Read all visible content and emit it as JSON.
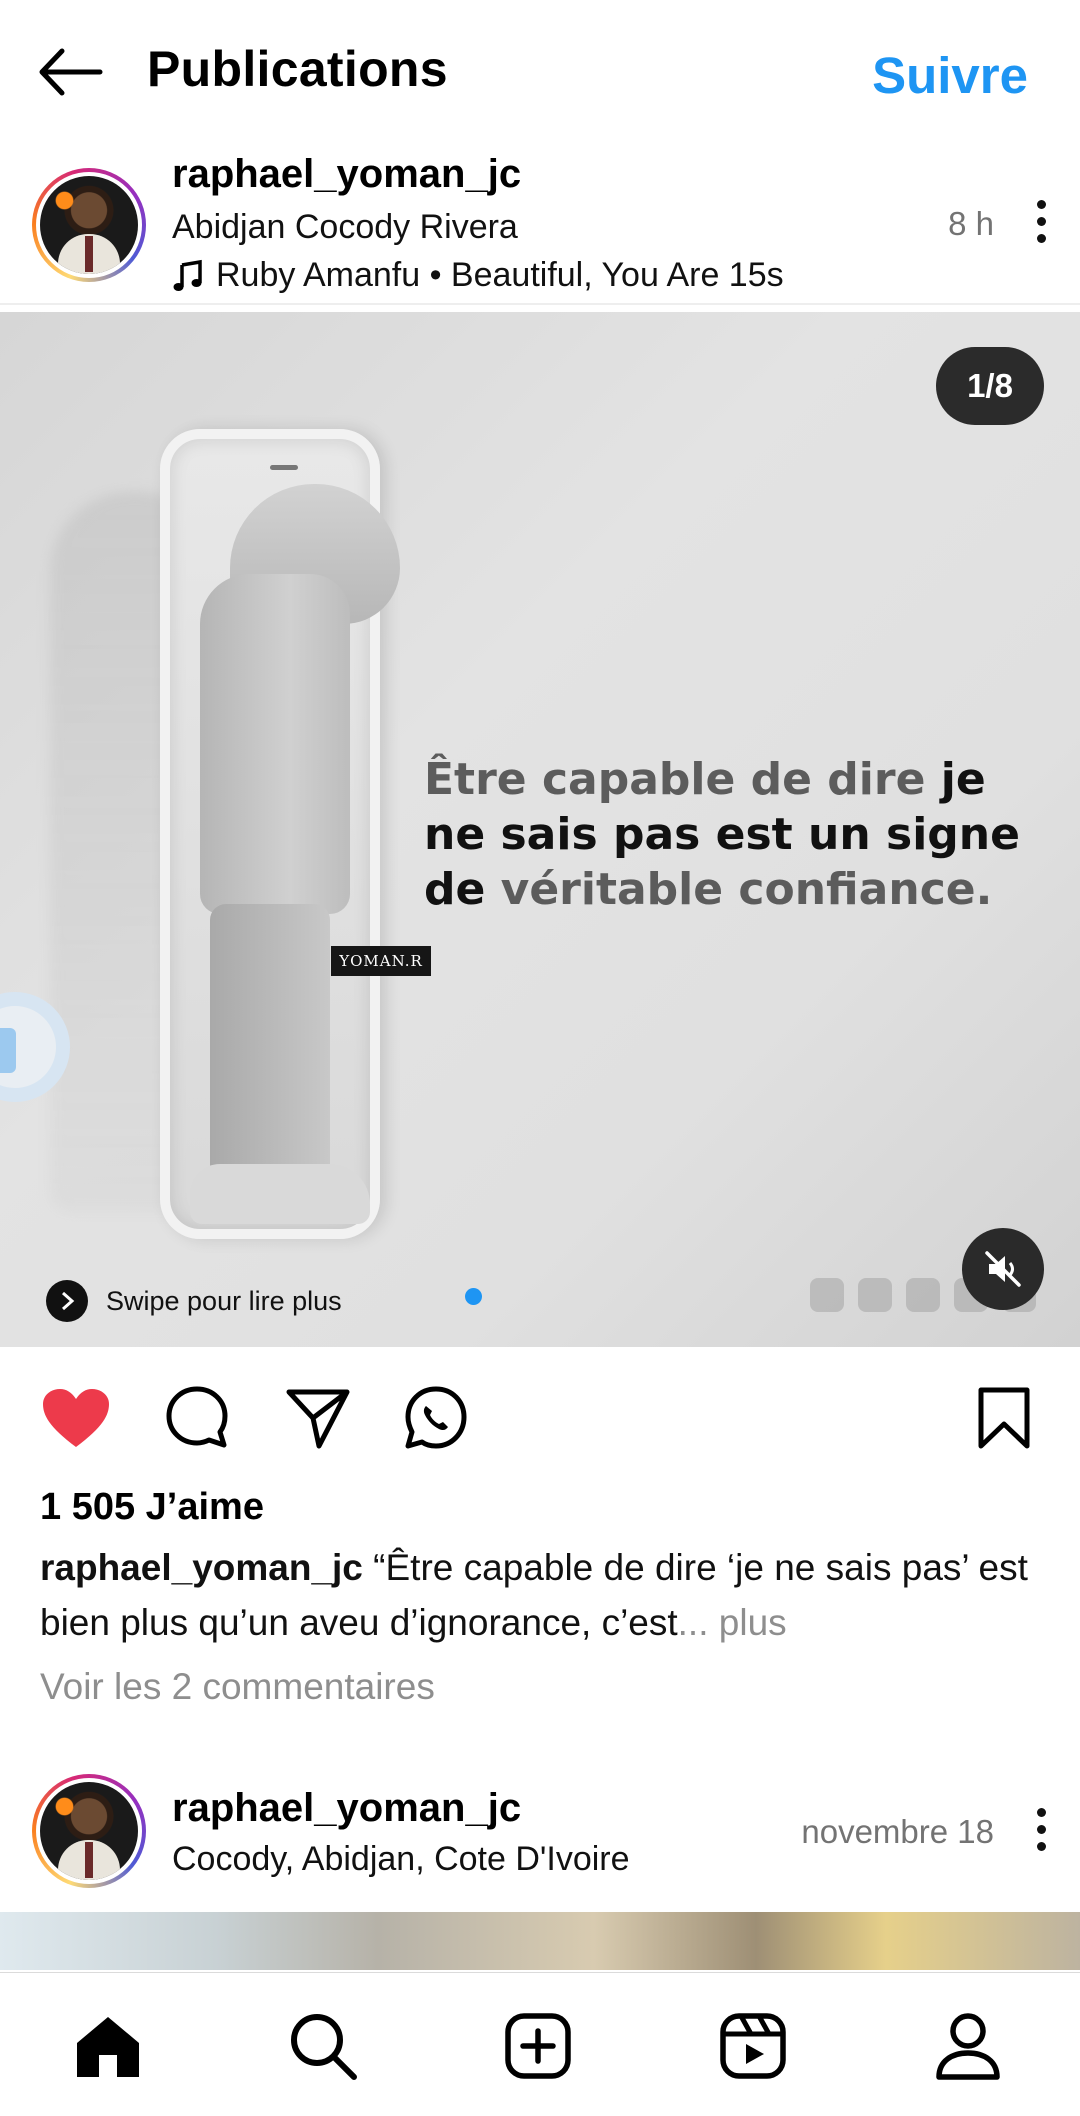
{
  "header": {
    "title": "Publications",
    "follow_label": "Suivre"
  },
  "post1": {
    "username": "raphael_yoman_jc",
    "location": "Abidjan Cocody Rivera",
    "music": "Ruby Amanfu • Beautiful, You Are 15s",
    "time": "8 h",
    "media": {
      "counter": "1/8",
      "tag": "YOMAN.R",
      "quote_part1": "Être capable de dire ",
      "quote_part2": "je ne sais pas est un signe de ",
      "quote_part3": "véritable confiance.",
      "swipe_label": "Swipe pour lire plus"
    },
    "likes": "1 505 J’aime",
    "caption_user": "raphael_yoman_jc",
    "caption_text": " “Être capable de dire ‘je ne sais pas’ est bien plus qu’un aveu d’ignorance, c’est",
    "caption_more": "... plus",
    "comments_link": "Voir les 2 commentaires"
  },
  "post2": {
    "username": "raphael_yoman_jc",
    "location": "Cocody, Abidjan, Cote D'Ivoire",
    "time": "novembre 18"
  },
  "colors": {
    "accent": "#1e95f3",
    "like": "#ed3a4b",
    "muted": "#8e8e8e"
  },
  "nav": {
    "items": [
      "home-icon",
      "search-icon",
      "create-icon",
      "reels-icon",
      "profile-icon"
    ]
  }
}
